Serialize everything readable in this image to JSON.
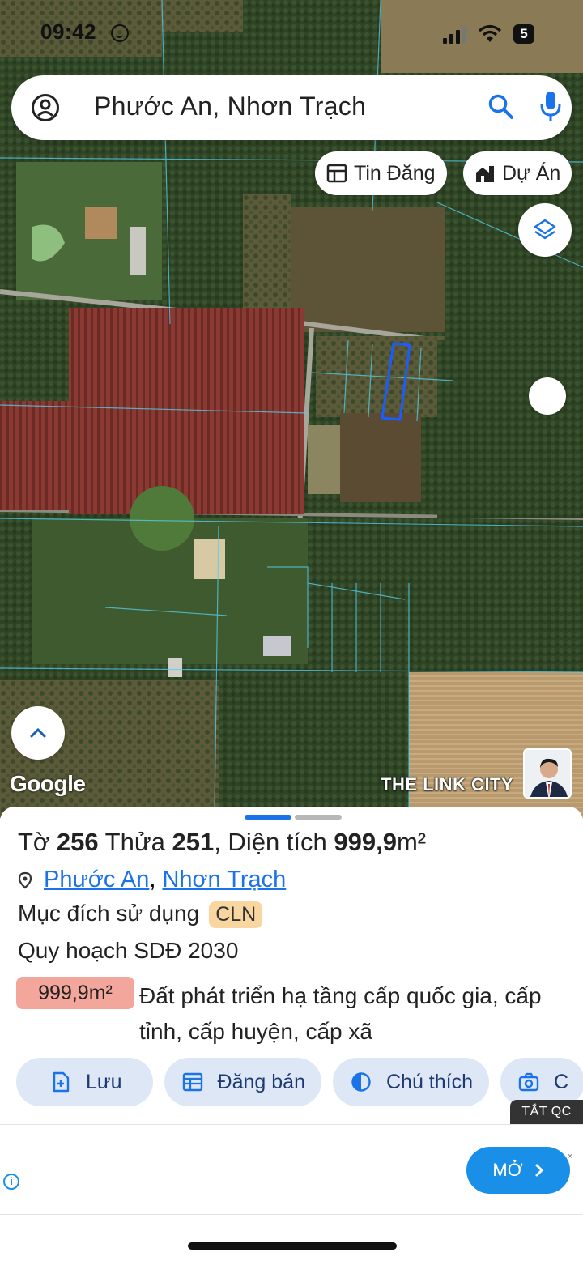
{
  "status_bar": {
    "time": "09:42",
    "battery": "5"
  },
  "search": {
    "query": "Phước An, Nhơn Trạch"
  },
  "chips": {
    "listings": "Tin Đăng",
    "projects": "Dự Án"
  },
  "map": {
    "attribution": "Google",
    "brand": "THE LINK CITY"
  },
  "parcel": {
    "title_prefix": "Tờ ",
    "sheet_no": "256",
    "lot_label": " Thửa ",
    "lot_no": "251",
    "area_label": ", Diện tích ",
    "area_value": "999,9",
    "area_unit": "m²",
    "location_ward": "Phước An",
    "location_sep": ", ",
    "location_district": "Nhơn Trạch",
    "usage_label": "Mục đích sử dụng",
    "usage_code": "CLN",
    "planning_label": "Quy hoạch SDĐ 2030",
    "planning_area": "999,9m²",
    "planning_desc": "Đất phát triển hạ tầng cấp quốc gia, cấp tỉnh, cấp huyện, cấp xã"
  },
  "actions": {
    "save": "Lưu",
    "post_sale": "Đăng bán",
    "legend": "Chú thích",
    "photo": "C"
  },
  "ad": {
    "hide_label": "TẮT QC",
    "open_label": "MỞ",
    "close": "×"
  },
  "colors": {
    "accent_blue": "#1a73e8",
    "action_bg": "#dde7f6",
    "usage_badge": "#f9d59f",
    "planning_badge": "#f3a69c",
    "ad_button": "#1a8fe8",
    "parcel_highlight": "#1c5cff"
  }
}
